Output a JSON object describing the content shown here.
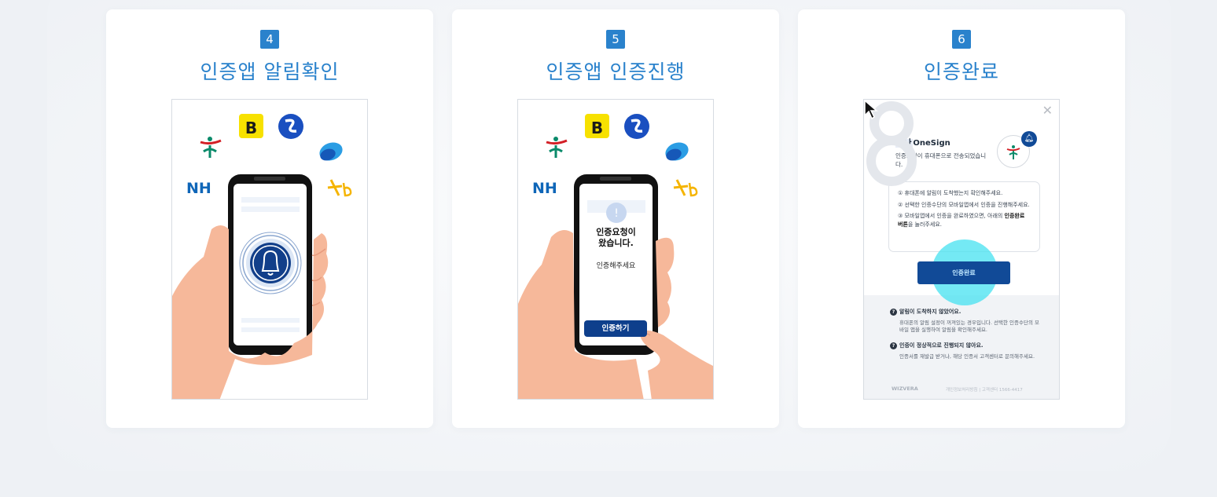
{
  "steps": [
    {
      "number": "4",
      "title": "인증앱 알림확인"
    },
    {
      "number": "5",
      "title": "인증앱 인증진행"
    },
    {
      "number": "6",
      "title": "인증완료"
    }
  ],
  "phone5": {
    "notice_line1": "인증요청이",
    "notice_line2": "왔습니다.",
    "instruction": "인증해주세요",
    "button": "인증하기"
  },
  "bank_logos": [
    "NH",
    "kb"
  ],
  "dialog": {
    "brand_prefix": "하나",
    "brand_name": "OneSign",
    "subtitle": "인증요청이 휴대폰으로 전송되었습니다.",
    "step1": "① 휴대폰에 알림이 도착했는지 확인해주세요.",
    "step2": "② 선택한 인증수단의 모바일앱에서 인증을 진행해주세요.",
    "step3_pre": "③ 모바일앱에서 인증을 완료하였으면, 아래의 ",
    "step3_bold": "인증완료 버튼",
    "step3_post": "을 눌러주세요.",
    "complete_button": "인증완료",
    "faq1_q": "알림이 도착하지 않았어요.",
    "faq1_a": "휴대폰의 알림 설정이 꺼져있는 경우입니다. 선택한 인증수단의 모바일 앱을 실행하여 알림을 확인해주세요.",
    "faq2_q": "인증이 정상적으로 진행되지 않아요.",
    "faq2_a": "인증서를 재발급 받거나, 해당 인증서 고객센터로 문의해주세요.",
    "footer_brand": "WIZVERA",
    "footer_links": "개인정보처리방침 | 고객센터 1566-4417"
  },
  "colors": {
    "accent": "#2a82cc",
    "navy": "#114a97",
    "skin": "#f6b89a",
    "highlight": "#46e1f0"
  }
}
